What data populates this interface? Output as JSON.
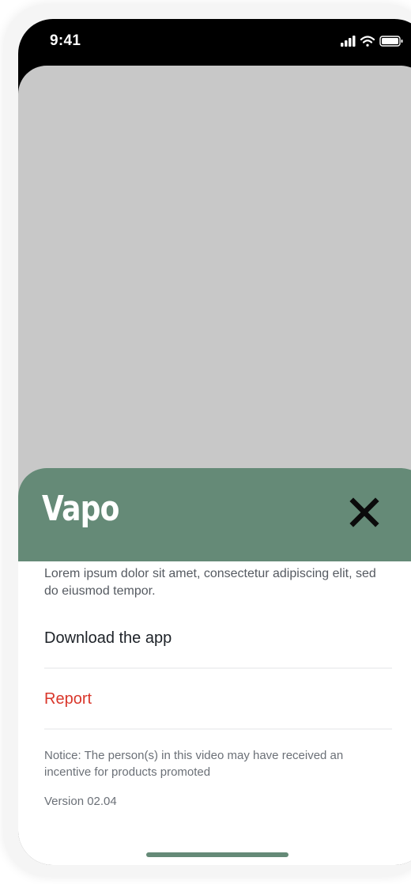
{
  "status_bar": {
    "time": "9:41",
    "icons": [
      "signal-icon",
      "wifi-icon",
      "battery-icon"
    ]
  },
  "sheet": {
    "brand": "Vapo",
    "close_icon": "close-icon",
    "description": "Lorem ipsum dolor sit amet, consectetur adipiscing elit, sed do eiusmod tempor.",
    "download_label": "Download the app",
    "report_label": "Report",
    "notice": "Notice: The person(s) in this video may have received an incentive for products promoted",
    "version": "Version 02.04"
  },
  "colors": {
    "accent": "#658a77",
    "report": "#d9372b",
    "video_placeholder": "#c8c8c8"
  }
}
